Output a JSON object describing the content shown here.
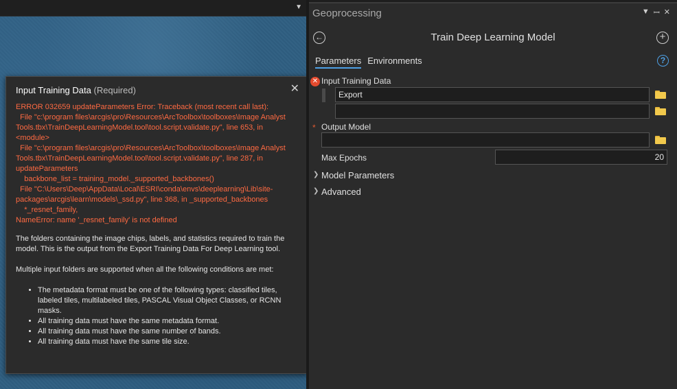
{
  "map": {},
  "popup": {
    "title": "Input Training Data",
    "required": "(Required)",
    "error_text": "ERROR 032659 updateParameters Error: Traceback (most recent call last):\n  File \"c:\\program files\\arcgis\\pro\\Resources\\ArcToolbox\\toolboxes\\Image Analyst Tools.tbx\\TrainDeepLearningModel.tool\\tool.script.validate.py\", line 653, in <module>\n  File \"c:\\program files\\arcgis\\pro\\Resources\\ArcToolbox\\toolboxes\\Image Analyst Tools.tbx\\TrainDeepLearningModel.tool\\tool.script.validate.py\", line 287, in updateParameters\n    backbone_list = training_model._supported_backbones()\n  File \"C:\\Users\\Deep\\AppData\\Local\\ESRI\\conda\\envs\\deeplearning\\Lib\\site-packages\\arcgis\\learn\\models\\_ssd.py\", line 368, in _supported_backbones\n    *_resnet_family,\nNameError: name '_resnet_family' is not defined",
    "description": "The folders containing the image chips, labels, and statistics required to train the model. This is the output from the Export Training Data For Deep Learning tool.",
    "description2": "Multiple input folders are supported when all the following conditions are met:",
    "conditions": [
      "The metadata format must be one of the following types: classified tiles, labeled tiles, multilabeled tiles, PASCAL Visual Object Classes, or RCNN masks.",
      "All training data must have the same metadata format.",
      "All training data must have the same number of bands.",
      "All training data must have the same tile size."
    ]
  },
  "pane": {
    "title": "Geoprocessing",
    "tool_title": "Train Deep Learning Model",
    "tabs": [
      "Parameters",
      "Environments"
    ],
    "help": "?"
  },
  "params": {
    "input_training_data_label": "Input Training Data",
    "input_values": [
      "Export",
      ""
    ],
    "output_model_label": "Output Model",
    "output_model_value": "",
    "max_epochs_label": "Max Epochs",
    "max_epochs_value": "20",
    "groups": [
      "Model Parameters",
      "Advanced"
    ]
  }
}
